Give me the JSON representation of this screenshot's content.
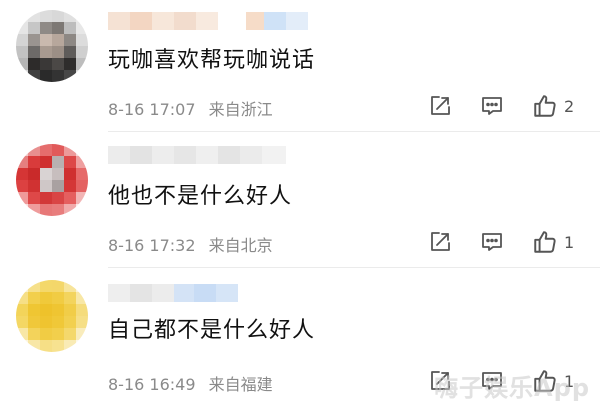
{
  "comments": [
    {
      "text": "玩咖喜欢帮玩咖说话",
      "time": "8-16 17:07",
      "location": "来自浙江",
      "likes": "2",
      "icons": [
        "share-icon",
        "comment-icon",
        "like-icon"
      ]
    },
    {
      "text": "他也不是什么好人",
      "time": "8-16 17:32",
      "location": "来自北京",
      "likes": "1",
      "icons": [
        "share-icon",
        "comment-icon",
        "like-icon"
      ]
    },
    {
      "text": "自己都不是什么好人",
      "time": "8-16 16:49",
      "location": "来自福建",
      "likes": "1",
      "icons": [
        "share-icon",
        "comment-icon",
        "like-icon"
      ]
    }
  ],
  "watermark": {
    "text": "嗨子娱乐App"
  },
  "colors": {
    "text": "#111111",
    "meta": "#8a8a8a",
    "icon": "#555555",
    "divider": "#ebebeb"
  }
}
